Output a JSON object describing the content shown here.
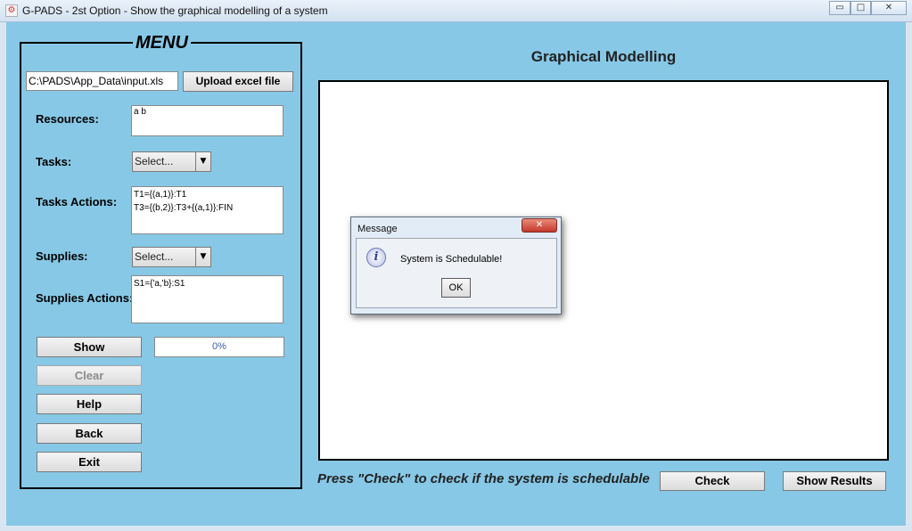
{
  "window": {
    "title": "G-PADS - 2st Option - Show the graphical modelling of a system",
    "minimize_glyph": "▭",
    "maximize_glyph": "□",
    "close_glyph": "✕",
    "app_icon_glyph": "⚙"
  },
  "menu": {
    "title": "MENU",
    "file_path": "C:\\PADS\\App_Data\\input.xls",
    "upload_label": "Upload excel file",
    "resources_label": "Resources:",
    "resources_value": "a b",
    "tasks_label": "Tasks:",
    "tasks_select": "Select...",
    "tasks_actions_label": "Tasks Actions:",
    "tasks_actions_value": "T1={(a,1)}:T1\nT3={(b,2)}:T3+{(a,1)}:FIN",
    "supplies_label": "Supplies:",
    "supplies_select": "Select...",
    "supplies_actions_label": "Supplies Actions:",
    "supplies_actions_value": "S1={'a,'b}:S1",
    "show_label": "Show",
    "progress_text": "0%",
    "progress_value": 0,
    "clear_label": "Clear",
    "help_label": "Help",
    "back_label": "Back",
    "exit_label": "Exit",
    "dropdown_glyph": "▼"
  },
  "main": {
    "title": "Graphical Modelling",
    "hint": "Press \"Check\" to check if the system is schedulable",
    "check_label": "Check",
    "results_label": "Show Results"
  },
  "dialog": {
    "title": "Message",
    "icon_glyph": "i",
    "message": "System is Schedulable!",
    "ok_label": "OK",
    "close_glyph": "✕"
  },
  "colors": {
    "panel_bg": "#87c8e6",
    "disabled_text": "#8c8c8c",
    "progress_text": "#3a5fb0"
  }
}
